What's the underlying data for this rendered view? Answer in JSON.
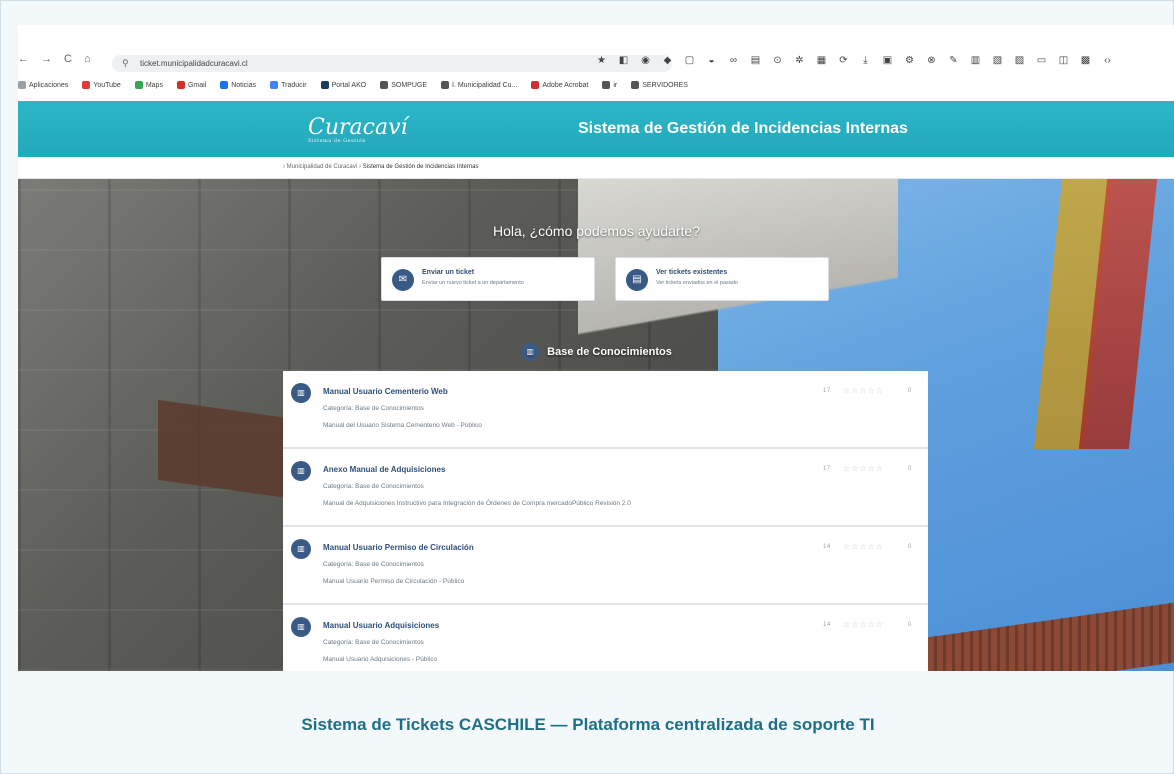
{
  "browser": {
    "nav": {
      "back": "←",
      "forward": "→",
      "reload": "C",
      "home": "⌂"
    },
    "url": "ticket.municipalidadcuracavi.cl",
    "bookmarks": [
      {
        "label": "Aplicaciones",
        "color": "#9aa0a6"
      },
      {
        "label": "YouTube",
        "color": "#e53935"
      },
      {
        "label": "Maps",
        "color": "#34a853"
      },
      {
        "label": "Gmail",
        "color": "#d93025"
      },
      {
        "label": "Noticias",
        "color": "#1a73e8"
      },
      {
        "label": "Traducir",
        "color": "#4285f4"
      },
      {
        "label": "Portal AKO",
        "color": "#1e3a5f"
      },
      {
        "label": "SOMPUGE",
        "color": "#555555"
      },
      {
        "label": "I. Municipalidad Cu...",
        "color": "#555555"
      },
      {
        "label": "Adobe Acrobat",
        "color": "#d32f2f"
      },
      {
        "label": "ir",
        "color": "#555555"
      },
      {
        "label": "SERVIDORES",
        "color": "#555555"
      }
    ]
  },
  "site": {
    "logo": "Curacaví",
    "logo_sub": "Sistema de Gestión",
    "title": "Sistema de Gestión de Incidencias Internas",
    "breadcrumb_home": "Municipalidad de Curacaví",
    "breadcrumb_current": "Sistema de Gestión de Incidencias Internas"
  },
  "hero": {
    "greeting": "Hola, ¿cómo podemos ayudarte?",
    "actions": [
      {
        "title": "Enviar un ticket",
        "subtitle": "Enviar un nuevo ticket a un departamento"
      },
      {
        "title": "Ver tickets existentes",
        "subtitle": "Ver tickets enviados en el pasado"
      }
    ],
    "kb_title": "Base de Conocimientos"
  },
  "kb_items": [
    {
      "title": "Manual Usuario Cementerio Web",
      "category": "Categoría: Base de Conocimientos",
      "description": "Manual del Usuario Sistema Cementerio Web - Público",
      "meta": "17",
      "views": "0"
    },
    {
      "title": "Anexo Manual de Adquisiciones",
      "category": "Categoría: Base de Conocimientos",
      "description": "Manual de Adquisiciones Instructivo para Integración de Órdenes de Compra mercadoPúblico Revisión 2.0",
      "meta": "17",
      "views": "0"
    },
    {
      "title": "Manual Usuario Permiso de Circulación",
      "category": "Categoría: Base de Conocimientos",
      "description": "Manual Usuario Permiso de Circulación - Público",
      "meta": "14",
      "views": "0"
    },
    {
      "title": "Manual Usuario Adquisiciones",
      "category": "Categoría: Base de Conocimientos",
      "description": "Manual Usuario Adquisiciones - Público",
      "meta": "14",
      "views": "0"
    }
  ],
  "caption": "Sistema de Tickets CASCHILE — Plataforma centralizada de soporte TI",
  "colors": {
    "header": "#23a9bb",
    "accent": "#3a5a86",
    "caption": "#1f6f86"
  }
}
